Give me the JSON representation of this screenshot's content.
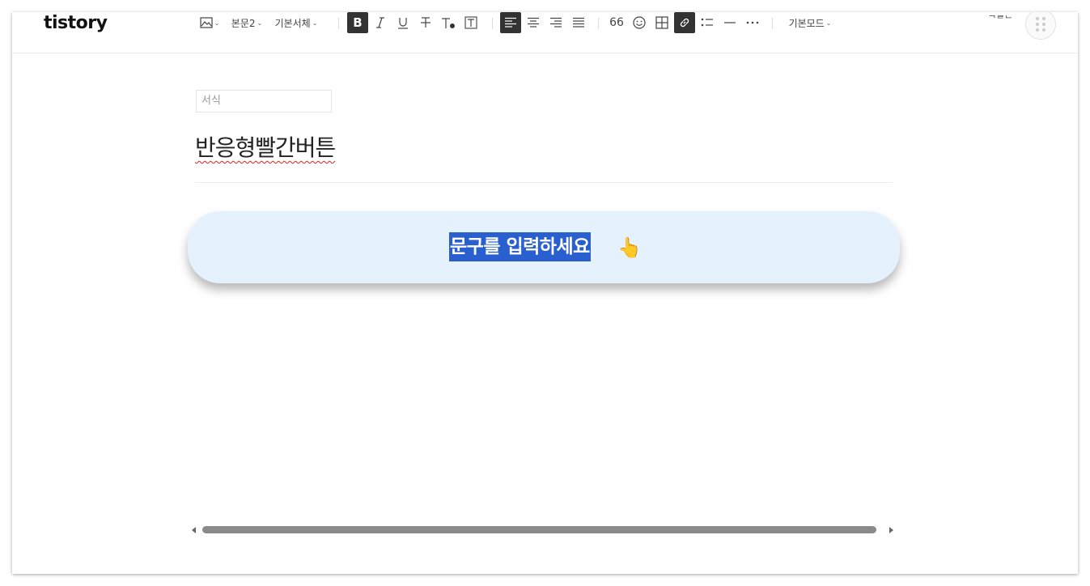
{
  "app": {
    "logo": "tistory"
  },
  "toolbar": {
    "image_icon": "image-icon",
    "paragraph_style": "본문2",
    "font_family": "기본서체",
    "bold": "B",
    "quote_glyph": "66",
    "mode": "기본모드",
    "profile_text": "ᆨᆯᆫ"
  },
  "editor": {
    "category_placeholder": "서식",
    "title": "반응형빨간버튼",
    "button_text": "문구를 입력하세요",
    "button_icon": "👆"
  },
  "colors": {
    "accent_dark": "#333333",
    "selection": "#2a5fcf",
    "button_bg": "#e5f2fd",
    "spellcheck": "#e02020"
  }
}
